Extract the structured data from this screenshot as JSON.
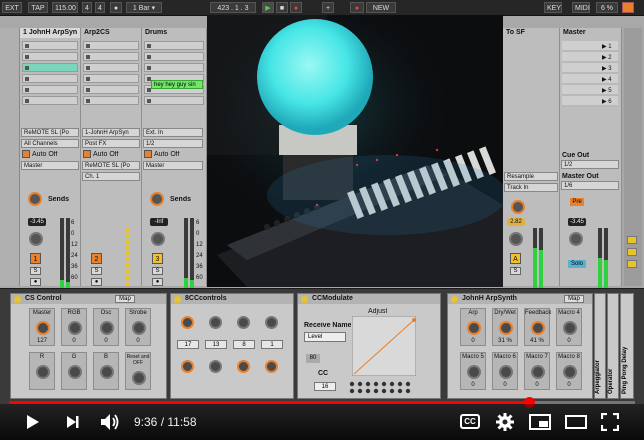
{
  "topbar": {
    "ext": "EXT",
    "tap": "TAP",
    "tempo": "115.00",
    "meter_num": "4",
    "meter_den": "4",
    "quant": "1 Bar",
    "position": "423 . 1 . 3",
    "new_label": "NEW",
    "key_label": "KEY",
    "midi_label": "MIDI",
    "cpu": "6 %"
  },
  "tracks": [
    {
      "name": "1 JohnH ArpSyn",
      "input": "ReMOTE SL (Po",
      "channel": "All Channels",
      "out": "Master",
      "send": "-3.45",
      "num": "1"
    },
    {
      "name": "Arp2CS",
      "input": "1-JohnH ArpSyn",
      "channel": "Post FX",
      "out": "ReMOTE SL (Po",
      "sub": "Ch. 1",
      "num": "2"
    },
    {
      "name": "Drums",
      "input": "Ext. In",
      "channel": "1/2",
      "out": "Master",
      "send": "-Inf",
      "num": "3",
      "clip": "hey hey guy sin"
    }
  ],
  "right_tracks": [
    {
      "name": "To SF",
      "out": "Resample",
      "sub": "Track In",
      "send": "2.82",
      "num": "A"
    },
    {
      "name": "Master",
      "cue_label": "Cue Out",
      "cue": "1/2",
      "master_label": "Master Out",
      "master": "1/6",
      "send": "-3.45"
    }
  ],
  "scenes": [
    "1",
    "2",
    "3",
    "4",
    "5",
    "6"
  ],
  "sends_label": "Sends",
  "meter_scale": [
    "6",
    "0",
    "12",
    "24",
    "36",
    "60"
  ],
  "devices": {
    "cs_control": {
      "title": "CS Control",
      "map": "Map",
      "cells": [
        {
          "label": "Master",
          "value": "127"
        },
        {
          "label": "RGB",
          "value": "0"
        },
        {
          "label": "Osc",
          "value": "0"
        },
        {
          "label": "Strobe",
          "value": "0"
        },
        {
          "label": "R",
          "value": ""
        },
        {
          "label": "G",
          "value": ""
        },
        {
          "label": "B",
          "value": ""
        },
        {
          "label": "Reset and OFF",
          "value": ""
        }
      ]
    },
    "cc_controls": {
      "title": "8CCcontrols",
      "top_labels": [
        "A",
        "B",
        "C",
        "D"
      ],
      "top_values": [
        "127",
        "0",
        "0",
        "4"
      ],
      "top_cc": [
        "17",
        "13",
        "8",
        "1"
      ],
      "bottom_labels": [
        "E",
        "F",
        "G",
        "H"
      ],
      "bottom_values": [
        "62",
        "6",
        "74",
        "69"
      ]
    },
    "cc_modulate": {
      "title": "CCModulate",
      "adjust": "Adjust",
      "receive_label": "Receive Name",
      "receive_value": "Level",
      "value_label": "80",
      "cc_label": "CC",
      "cc_value": "16"
    },
    "arp_synth": {
      "title": "JohnH ArpSynth",
      "map": "Map",
      "cells": [
        {
          "label": "Arp",
          "value": "0"
        },
        {
          "label": "Dry/Wet",
          "value": "31 %"
        },
        {
          "label": "Feedback",
          "value": "41 %"
        },
        {
          "label": "Macro 4",
          "value": "0"
        },
        {
          "label": "Macro 5",
          "value": "0"
        },
        {
          "label": "Macro 6",
          "value": "0"
        },
        {
          "label": "Macro 7",
          "value": "0"
        },
        {
          "label": "Macro 8",
          "value": "0"
        }
      ],
      "side_labels": [
        "Arpeggiator",
        "Operator",
        "Ping Pong Delay"
      ]
    }
  },
  "player": {
    "time": "9:36 / 11:58",
    "progress": 0.83,
    "cc_label": "CC"
  },
  "colors": {
    "accent_orange": "#e8802c",
    "meter_green": "#2fd13f",
    "progress_red": "#ff0000",
    "orb_cyan": "#47e6e6",
    "clip_green": "#76e46a"
  }
}
